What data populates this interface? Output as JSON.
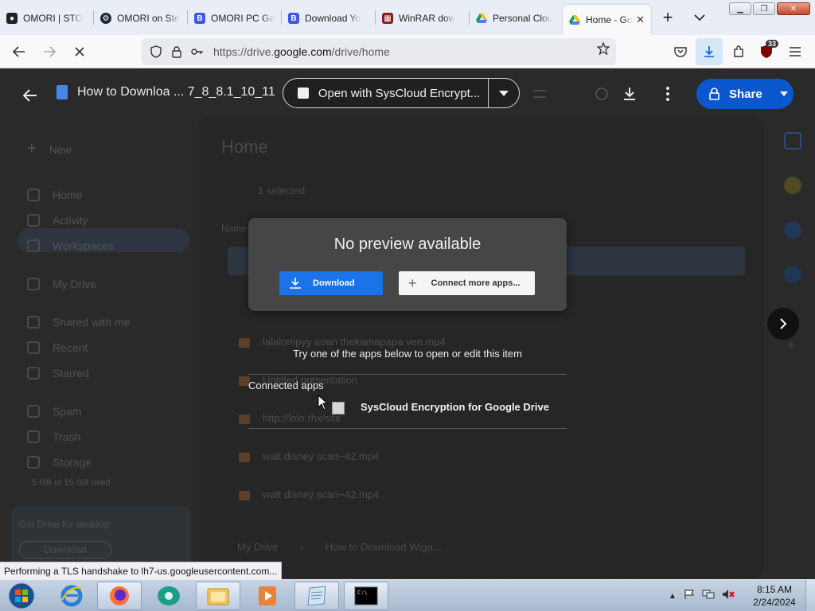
{
  "browser": {
    "tabs": [
      {
        "title": "OMORI | STO",
        "favicon": "omori-icon",
        "color": "#222222"
      },
      {
        "title": "OMORI on Ste",
        "favicon": "steam-icon",
        "color": "#1b2838"
      },
      {
        "title": "OMORI PC Ga",
        "favicon": "site-icon",
        "color": "#3b5bdb"
      },
      {
        "title": "Download Yo",
        "favicon": "site-icon",
        "color": "#3b5bdb"
      },
      {
        "title": "WinRAR dow",
        "favicon": "winrar-icon",
        "color": "#8b1a1a"
      },
      {
        "title": "Personal Clou",
        "favicon": "google-drive-icon",
        "color": "#0f9d58"
      },
      {
        "title": "Home - Go",
        "favicon": "google-drive-icon",
        "color": "#0f9d58",
        "active": true
      }
    ],
    "url_prefix": "https://drive.",
    "url_domain": "google.com",
    "url_path": "/drive/home",
    "extension_badge": "33",
    "status_tooltip": "Performing a TLS handshake to lh7-us.googleusercontent.com..."
  },
  "viewer": {
    "doc_title": "How to Downloa ... 7_8_8.1_10_11",
    "open_with_label": "Open with SysCloud Encrypt...",
    "share_label": "Share"
  },
  "drive": {
    "new_label": "New",
    "home_heading": "Home",
    "selected_text": "1 selected",
    "name_col": "Name",
    "sidebar": [
      "Home",
      "Activity",
      "Workspaces",
      "My Drive",
      "Shared with me",
      "Recent",
      "Starred",
      "Spam",
      "Trash",
      "Storage"
    ],
    "storage_used": "5 GB of 15 GB used",
    "get_drive": "Get Drive for desktop",
    "get_drive_btn": "Download",
    "files": [
      "lalalompyy aoan thekamapapa ven.mp4",
      "Untitled presentation",
      "http://lolo.rhx/site",
      "walt disney scan~42.mp4",
      "walt disney scan~42.mp4"
    ],
    "breadcrumb_root": "My Drive",
    "breadcrumb_file": "How to Download Wiga..."
  },
  "dialog": {
    "title": "No preview available",
    "download_label": "Download",
    "connect_label": "Connect more apps...",
    "try_text": "Try one of the apps below to open or edit this item",
    "connected_apps_label": "Connected apps",
    "app_name": "SysCloud Encryption for Google Drive"
  },
  "taskbar": {
    "apps": [
      "internet-explorer-icon",
      "firefox-icon",
      "media-app-icon",
      "file-explorer-icon",
      "media-player-icon",
      "notepad-icon",
      "cmd-icon"
    ],
    "time": "8:15 AM",
    "date": "2/24/2024"
  },
  "colors": {
    "accent": "#0b57d0",
    "download_blue": "#1a73e8",
    "dialog_bg": "#464646"
  }
}
